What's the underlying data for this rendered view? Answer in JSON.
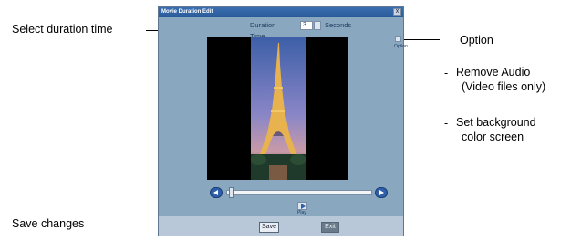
{
  "annotations": {
    "select_duration": "Select duration time",
    "save_changes": "Save changes",
    "option": "Option",
    "remove_audio_line1": "Remove Audio",
    "remove_audio_line2": "(Video files only)",
    "set_bg_line1": "Set background",
    "set_bg_line2": "color screen",
    "bullet": "-"
  },
  "dialog": {
    "title": "Movie Duration Edit",
    "close_glyph": "x",
    "duration_label": "Duration Time",
    "duration_value": "3",
    "duration_unit": "Seconds",
    "option_label": "Option",
    "play_label": "Play",
    "save_label": "Save",
    "cancel_label": "Exit"
  },
  "icons": {
    "close": "close-icon",
    "spin": "spinner-arrows-icon",
    "seek_back": "seek-left-icon",
    "seek_forward": "seek-right-icon",
    "play": "play-icon",
    "option": "option-icon"
  },
  "colors": {
    "dialog_bg": "#8aa7c0",
    "titlebar": "#2a5a98",
    "seek_button": "#2f5fa8"
  }
}
